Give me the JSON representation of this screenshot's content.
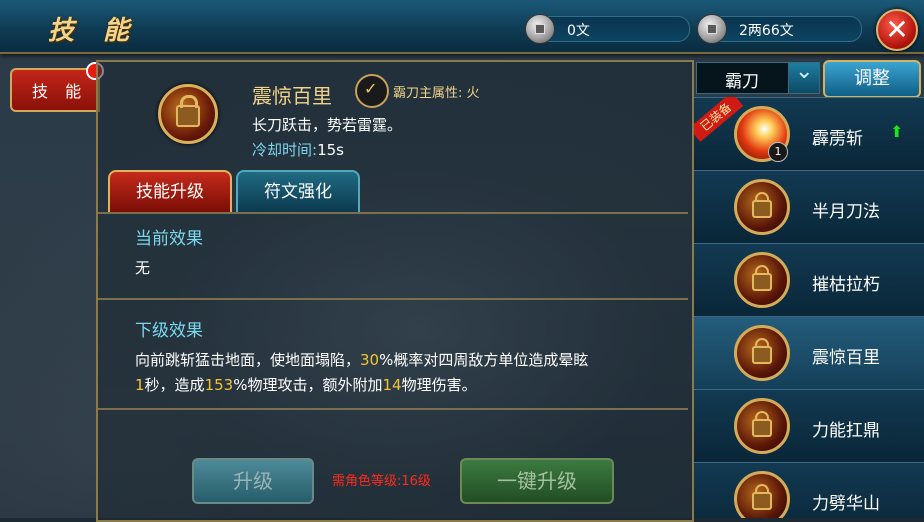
{
  "header": {
    "title": "技 能",
    "currency_copper": "0文",
    "currency_silver": "2两66文"
  },
  "side_tab": {
    "label": "技 能"
  },
  "skill": {
    "name": "震惊百里",
    "attribute": "霸刀主属性: 火",
    "description": "长刀跃击，势若雷霆。",
    "cooldown_label": "冷却时间:",
    "cooldown_value": "15s"
  },
  "tabs": {
    "upgrade": "技能升级",
    "rune": "符文强化"
  },
  "current_effect": {
    "title": "当前效果",
    "text": "无"
  },
  "next_effect": {
    "title": "下级效果",
    "line1_a": "向前跳斩猛击地面，使地面塌陷，",
    "line1_pct": "30",
    "line1_b": "%概率对四周敌方单位造成晕眩",
    "line2_sec": "1",
    "line2_a": "秒，造成",
    "line2_dmg": "153",
    "line2_b": "%物理攻击，额外附加",
    "line2_extra": "14",
    "line2_c": "物理伤害。"
  },
  "footer": {
    "upgrade_button": "升级",
    "requirement": "需角色等级:16级",
    "oneclick_button": "一键升级"
  },
  "right": {
    "dropdown_value": "霸刀",
    "adjust_button": "调整",
    "equipped_badge": "已装备",
    "skills": [
      {
        "name": "霹雳斩",
        "level": "1",
        "equipped": true,
        "upgradable": true
      },
      {
        "name": "半月刀法"
      },
      {
        "name": "摧枯拉朽"
      },
      {
        "name": "震惊百里",
        "selected": true
      },
      {
        "name": "力能扛鼎"
      },
      {
        "name": "力劈华山"
      }
    ]
  }
}
